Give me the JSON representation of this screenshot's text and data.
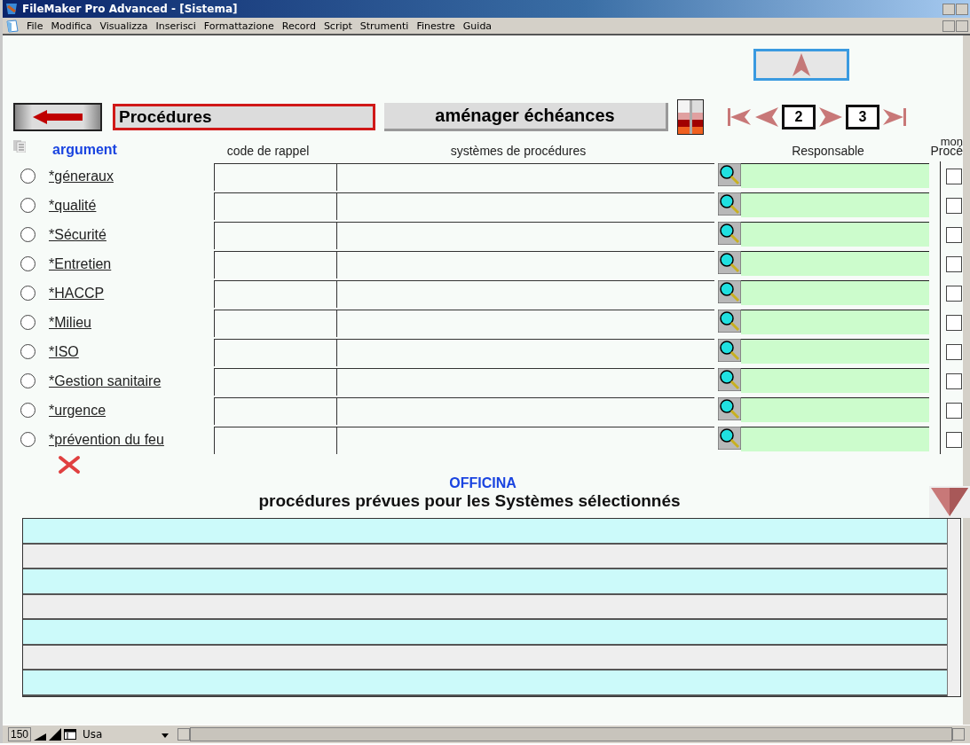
{
  "window": {
    "title": "FileMaker Pro Advanced - [Sistema]"
  },
  "menu": [
    "File",
    "Modifica",
    "Visualizza",
    "Inserisci",
    "Formattazione",
    "Record",
    "Script",
    "Strumenti",
    "Finestre",
    "Guida"
  ],
  "toolbar": {
    "title_field": "Procédures",
    "schedule_button": "aménager échéances",
    "pages": [
      "2",
      "3"
    ]
  },
  "columns": [
    "argument",
    "code de rappel",
    "systèmes de procédures",
    "Responsable",
    "mon",
    "Procé"
  ],
  "rows": [
    {
      "label": "*géneraux",
      "selected": false,
      "checked": false
    },
    {
      "label": "*qualité",
      "selected": false,
      "checked": false
    },
    {
      "label": "*Sécurité",
      "selected": false,
      "checked": false
    },
    {
      "label": "*Entretien",
      "selected": false,
      "checked": false
    },
    {
      "label": "*HACCP",
      "selected": false,
      "checked": false
    },
    {
      "label": "*Milieu",
      "selected": false,
      "checked": false
    },
    {
      "label": "*ISO",
      "selected": false,
      "checked": false
    },
    {
      "label": "*Gestion sanitaire",
      "selected": false,
      "checked": false
    },
    {
      "label": "*urgence",
      "selected": false,
      "checked": false
    },
    {
      "label": "*prévention du feu",
      "selected": false,
      "checked": false
    }
  ],
  "section": {
    "subtitle": "OFFICINA",
    "title": "procédures prévues pour les Systèmes sélectionnés"
  },
  "status_bar": {
    "zoom": "150",
    "mode": "Usa"
  }
}
